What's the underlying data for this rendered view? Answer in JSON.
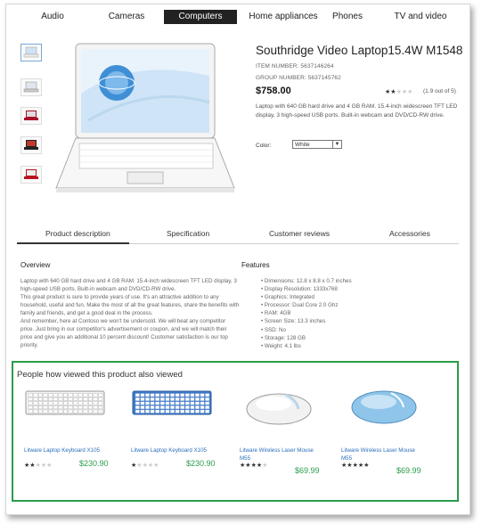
{
  "nav": [
    "Audio",
    "Cameras",
    "Computers",
    "Home appliances",
    "Phones",
    "TV and video"
  ],
  "nav_active": "Computers",
  "product": {
    "title": "Southridge Video Laptop15.4W M1548",
    "item_number": "ITEM NUMBER: 5637146264",
    "group_number": "GROUP NUMBER: 5637145762",
    "price": "$758.00",
    "rating": 2,
    "rating_text": "(1.9 out of 5)",
    "description": "Laptop with 640 GB hard drive and 4 GB RAM. 15.4-inch widescreen TFT LED display, 3 high-speed USB ports. Built-in webcam and DVD/CD-RW drive.",
    "color_label": "Color:",
    "color_value": "White"
  },
  "thumb_colors": [
    "#e8eef5",
    "#d9dde2",
    "#a8102a",
    "#222222",
    "#b5141e"
  ],
  "tabs": [
    "Product description",
    "Specification",
    "Customer reviews",
    "Accessories"
  ],
  "overview": {
    "heading": "Overview",
    "text": "Laptop with 640 GB hard drive and 4 GB RAM. 15.4-inch widescreen TFT LED display, 3 high-speed USB ports. Built-in webcam and DVD/CD-RW drive.\nThis great product is sure to provide years of use. It's an attractive addition to any household, useful and fun. Make the most of all the great features, share the benefits with family and friends, and get a good deal in the process.\nAnd remember, here at Contoso we won't be undersold. We will beat any competitor price. Just bring in our competitor's advertisement or coupon, and we will match their price and give you an additional 10 percent discount! Customer satisfaction is our top priority."
  },
  "features": {
    "heading": "Features",
    "items": [
      "Dimensions: 12.8 x 8.8 x 0.7 inches",
      "Display Resolution: 1333x768",
      "Graphics: Integrated",
      "Processor: Dual Core 2.0 Ghz",
      "RAM: 4GB",
      "Screen Size: 13.3 inches",
      "SSD: No",
      "Storage: 128 GB",
      "Weight: 4.1 lbs"
    ]
  },
  "viewed": {
    "title": "People how viewed this product also viewed",
    "products": [
      {
        "name": "Litware Laptop Keyboard X105",
        "rating": 2,
        "price": "$230.90",
        "image": "keyboard-white"
      },
      {
        "name": "Litware Laptop Keyboard X105",
        "rating": 1,
        "price": "$230.90",
        "image": "keyboard-blue"
      },
      {
        "name": "Litware Wireless Laser Mouse M55",
        "rating": 4,
        "price": "$69.99",
        "image": "mouse-white"
      },
      {
        "name": "Litware Wireless Laser Mouse M55",
        "rating": 5,
        "price": "$69.99",
        "image": "mouse-blue"
      }
    ]
  }
}
